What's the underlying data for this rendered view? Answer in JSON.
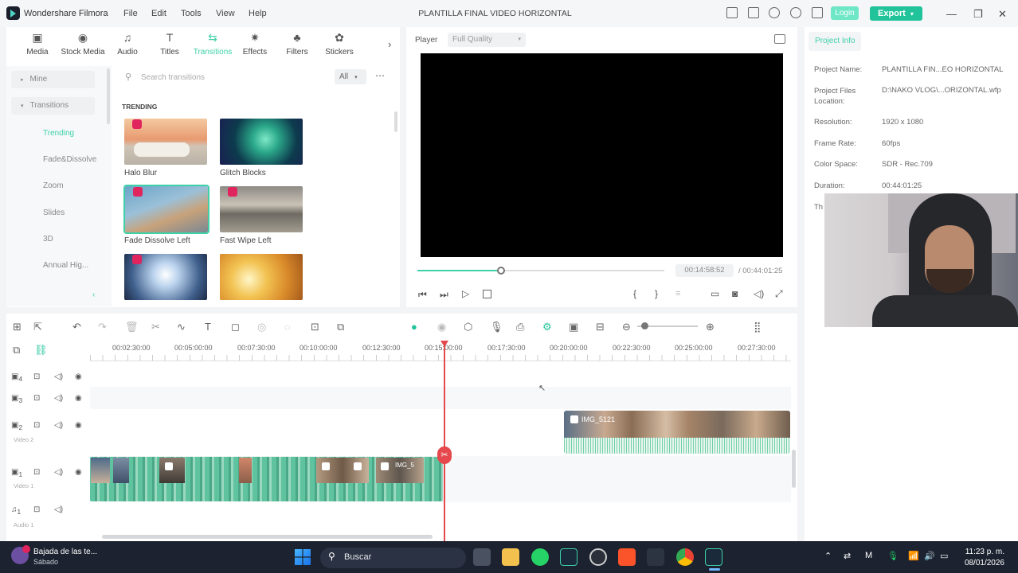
{
  "app": {
    "name": "Wondershare Filmora",
    "project_title": "PLANTILLA FINAL VIDEO HORIZONTAL",
    "menu": [
      "File",
      "Edit",
      "Tools",
      "View",
      "Help"
    ],
    "login_label": "Login",
    "export_label": "Export"
  },
  "media_tabs": [
    {
      "label": "Media",
      "icon": "media-icon",
      "active": false
    },
    {
      "label": "Stock Media",
      "icon": "stock-media-icon",
      "active": false
    },
    {
      "label": "Audio",
      "icon": "audio-icon",
      "active": false
    },
    {
      "label": "Titles",
      "icon": "titles-icon",
      "active": false
    },
    {
      "label": "Transitions",
      "icon": "transitions-icon",
      "active": true
    },
    {
      "label": "Effects",
      "icon": "effects-icon",
      "active": false
    },
    {
      "label": "Filters",
      "icon": "filters-icon",
      "active": false
    },
    {
      "label": "Stickers",
      "icon": "stickers-icon",
      "active": false
    }
  ],
  "sidebar": {
    "mine": "Mine",
    "transitions": "Transitions",
    "items": [
      "Trending",
      "Fade&Dissolve",
      "Zoom",
      "Slides",
      "3D",
      "Annual Hig..."
    ]
  },
  "library": {
    "search_placeholder": "Search transitions",
    "filter_value": "All",
    "section_title": "TRENDING",
    "items": [
      {
        "label": "Halo Blur",
        "premium": true
      },
      {
        "label": "Glitch Blocks",
        "premium": false
      },
      {
        "label": "Fade Dissolve Left",
        "premium": true
      },
      {
        "label": "Fast Wipe Left",
        "premium": true
      },
      {
        "label": "",
        "premium": true
      },
      {
        "label": "",
        "premium": false
      }
    ]
  },
  "player": {
    "label": "Player",
    "quality": "Full Quality",
    "current_time": "00:14:58:52",
    "total_time": "/ 00:44:01:25",
    "progress": 0.34
  },
  "project_info": {
    "tab": "Project Info",
    "rows": [
      {
        "key": "Project Name:",
        "value": "PLANTILLA FIN...EO HORIZONTAL"
      },
      {
        "key": "Project Files Location:",
        "value": "D:\\NAKO VLOG\\...ORIZONTAL.wfp"
      },
      {
        "key": "Resolution:",
        "value": "1920 x 1080"
      },
      {
        "key": "Frame Rate:",
        "value": "60fps"
      },
      {
        "key": "Color Space:",
        "value": "SDR - Rec.709"
      },
      {
        "key": "Duration:",
        "value": "00:44:01:25"
      },
      {
        "key": "Th",
        "value": ""
      }
    ]
  },
  "timeline": {
    "ruler": [
      "00:02:30:00",
      "00:05:00:00",
      "00:07:30:00",
      "00:10:00:00",
      "00:12:30:00",
      "00:15:00:00",
      "00:17:30:00",
      "00:20:00:00",
      "00:22:30:00",
      "00:25:00:00",
      "00:27:30:00"
    ],
    "tracks": [
      {
        "num": "4",
        "name": ""
      },
      {
        "num": "3",
        "name": ""
      },
      {
        "num": "2",
        "name": "Video 2"
      },
      {
        "num": "1",
        "name": "Video 1"
      },
      {
        "num": "1",
        "name": "Audio 1"
      }
    ],
    "clip_label": "IMG_5121",
    "small_clip_label": "IMG_5"
  },
  "taskbar": {
    "media_title": "Bajada de las te...",
    "media_sub": "Sábado",
    "search": "Buscar",
    "time": "11:23 p. m.",
    "date": "08/01/2026"
  },
  "colors": {
    "accent": "#21c39a",
    "accent_light": "#3ed1a8",
    "playhead": "#e5484d"
  }
}
